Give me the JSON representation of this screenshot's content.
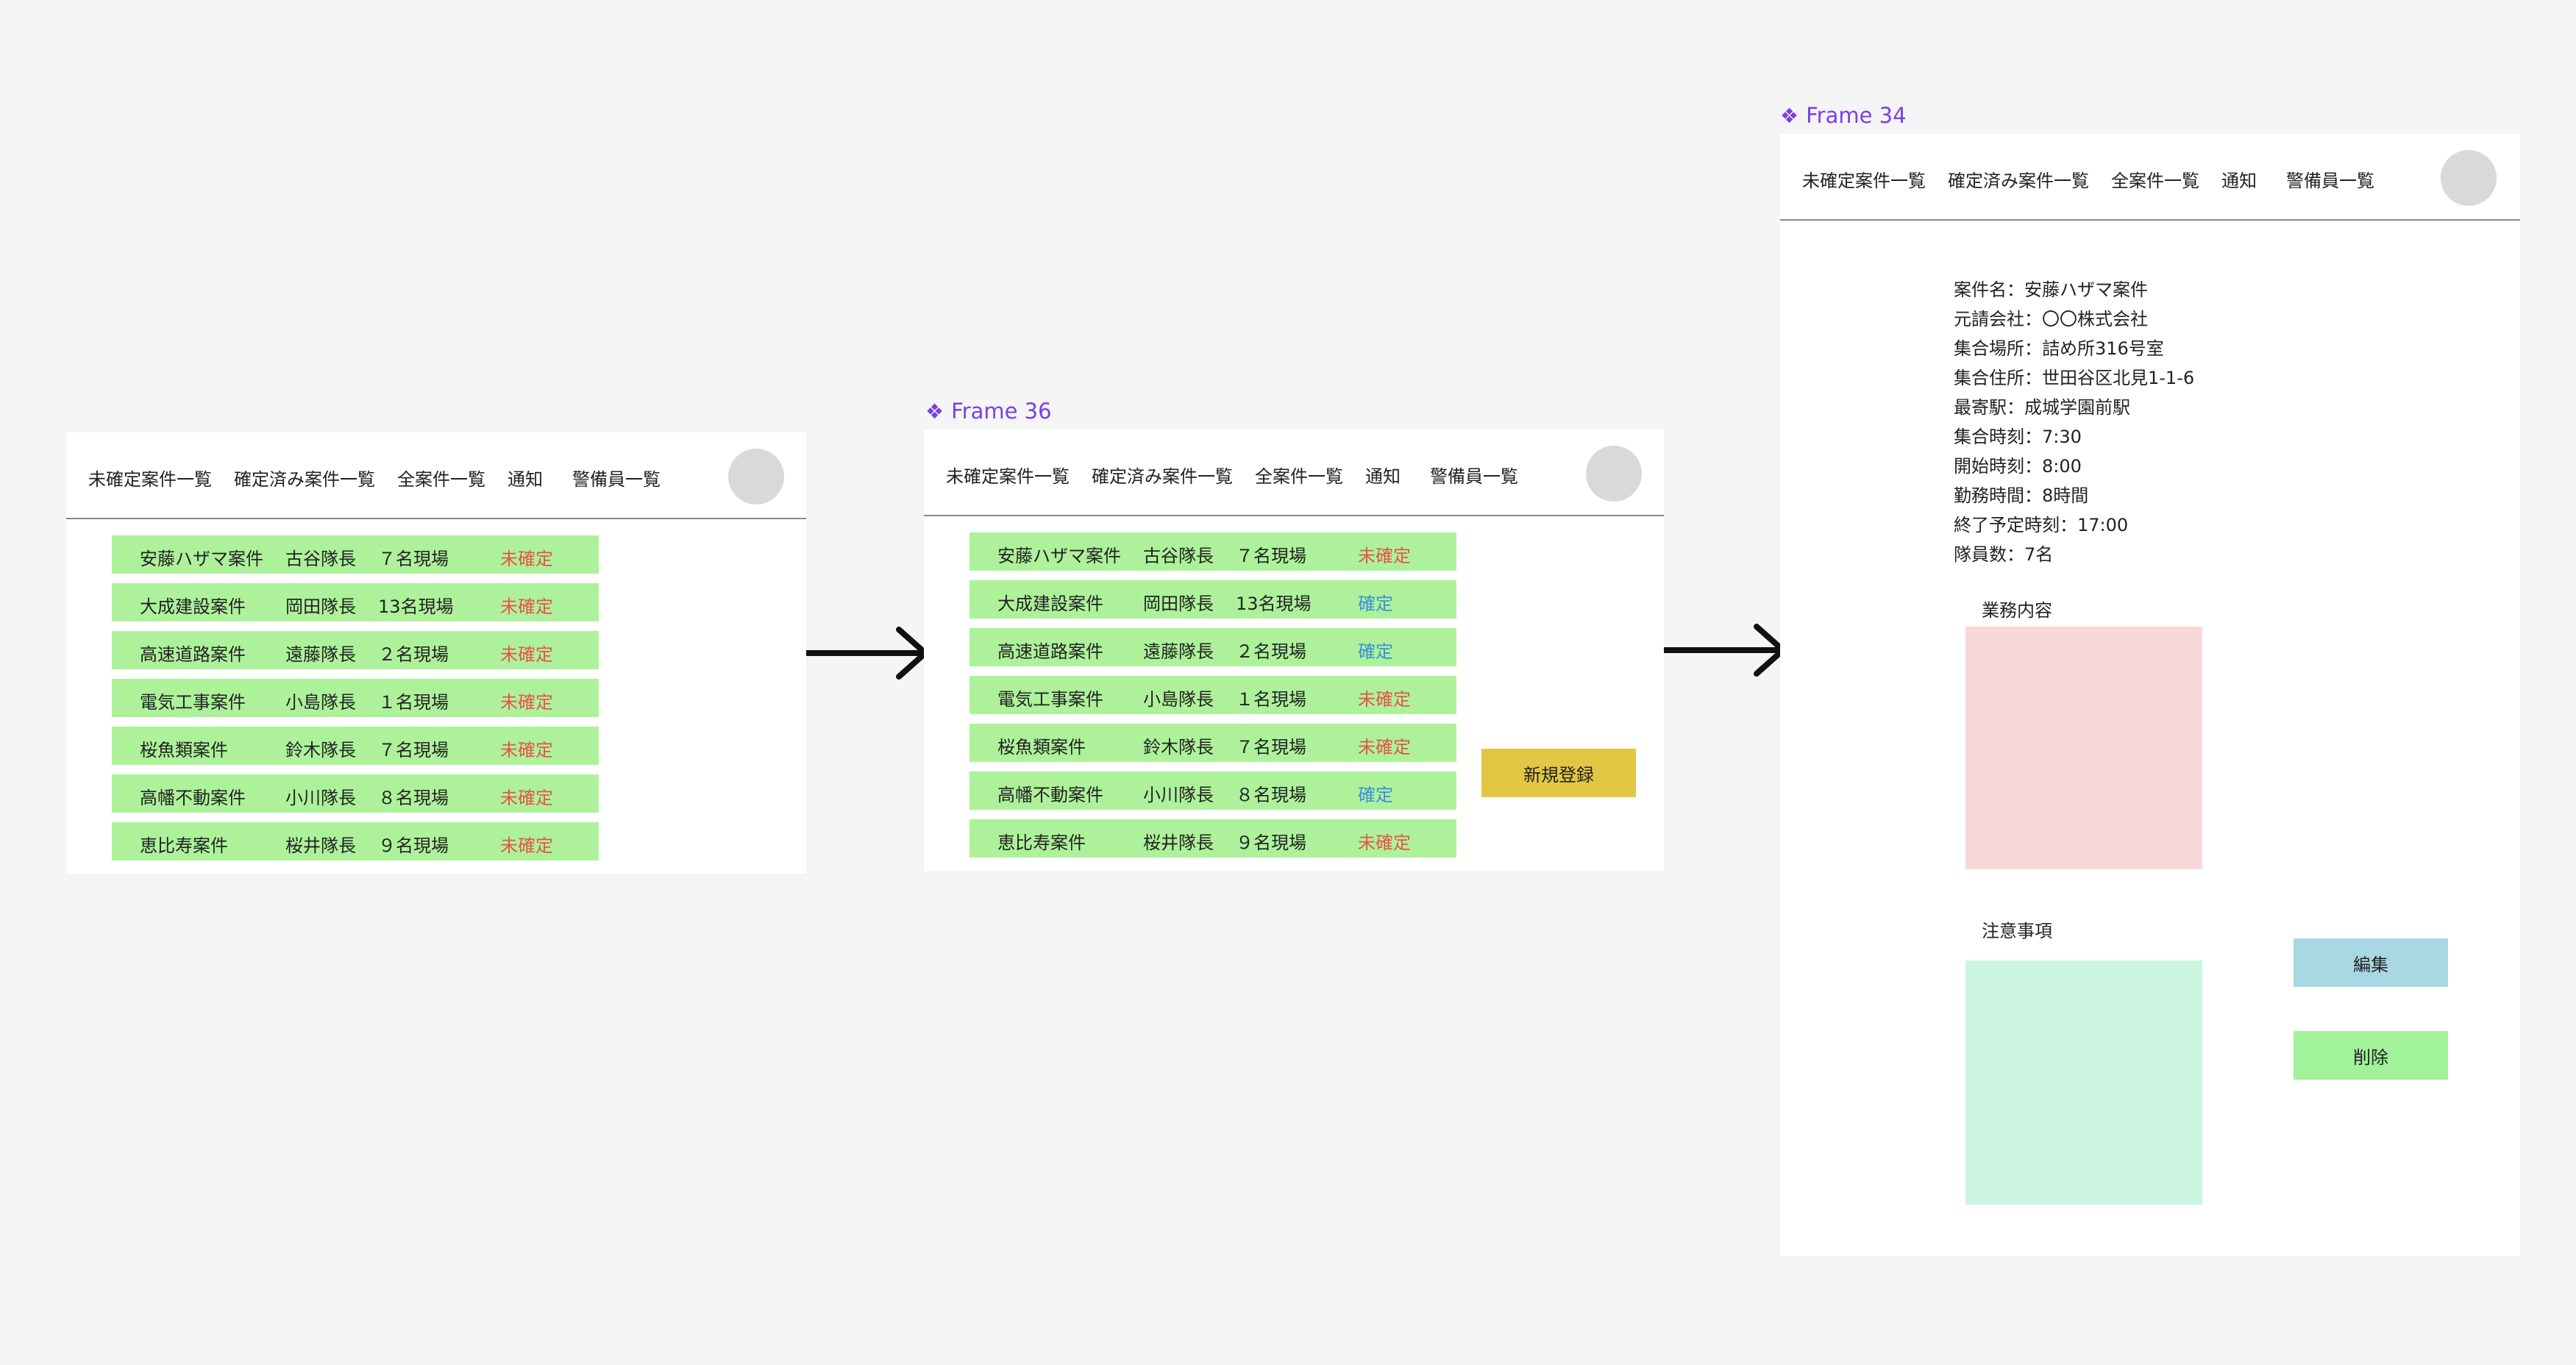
{
  "nav": [
    "未確定案件一覧",
    "確定済み案件一覧",
    "全案件一覧",
    "通知",
    "警備員一覧"
  ],
  "frame36": {
    "label": "Frame 36",
    "new_button": "新規登録"
  },
  "frame34": {
    "label": "Frame 34",
    "details": [
      "案件名：安藤ハザマ案件",
      "元請会社：〇〇株式会社",
      "集合場所：詰め所316号室",
      "集合住所：世田谷区北見1-1-6",
      "最寄駅：成城学園前駅",
      "集合時刻：7:30",
      "開始時刻：8:00",
      "勤務時間：8時間",
      "終了予定時刻：17:00",
      "隊員数：7名"
    ],
    "work_title": "業務内容",
    "notes_title": "注意事項",
    "edit_button": "編集",
    "delete_button": "削除"
  },
  "frame_left": {
    "rows": [
      {
        "name": "安藤ハザマ案件",
        "leader": "古谷隊長",
        "site": "７名現場",
        "status": "未確定"
      },
      {
        "name": "大成建設案件",
        "leader": "岡田隊長",
        "site": "13名現場",
        "status": "未確定"
      },
      {
        "name": "高速道路案件",
        "leader": "遠藤隊長",
        "site": "２名現場",
        "status": "未確定"
      },
      {
        "name": "電気工事案件",
        "leader": "小島隊長",
        "site": "１名現場",
        "status": "未確定"
      },
      {
        "name": "桜魚類案件",
        "leader": "鈴木隊長",
        "site": "７名現場",
        "status": "未確定"
      },
      {
        "name": "高幡不動案件",
        "leader": "小川隊長",
        "site": "８名現場",
        "status": "未確定"
      },
      {
        "name": "恵比寿案件",
        "leader": "桜井隊長",
        "site": "９名現場",
        "status": "未確定"
      }
    ]
  },
  "frame_mid": {
    "rows": [
      {
        "name": "安藤ハザマ案件",
        "leader": "古谷隊長",
        "site": "７名現場",
        "status": "未確定"
      },
      {
        "name": "大成建設案件",
        "leader": "岡田隊長",
        "site": "13名現場",
        "status": "確定"
      },
      {
        "name": "高速道路案件",
        "leader": "遠藤隊長",
        "site": "２名現場",
        "status": "確定"
      },
      {
        "name": "電気工事案件",
        "leader": "小島隊長",
        "site": "１名現場",
        "status": "未確定"
      },
      {
        "name": "桜魚類案件",
        "leader": "鈴木隊長",
        "site": "７名現場",
        "status": "未確定"
      },
      {
        "name": "高幡不動案件",
        "leader": "小川隊長",
        "site": "８名現場",
        "status": "確定"
      },
      {
        "name": "恵比寿案件",
        "leader": "桜井隊長",
        "site": "９名現場",
        "status": "未確定"
      }
    ]
  },
  "colors": {
    "row_bg": "#adf29a",
    "status_unconfirmed": "#e8534a",
    "status_confirmed": "#3a8fe0",
    "new_button": "#e2c744",
    "edit_button": "#a9d8e3",
    "delete_button": "#a2f29a",
    "work_box": "#f7d9d9",
    "notes_box": "#cbf5e0",
    "frame_label": "#7b3fe4"
  }
}
